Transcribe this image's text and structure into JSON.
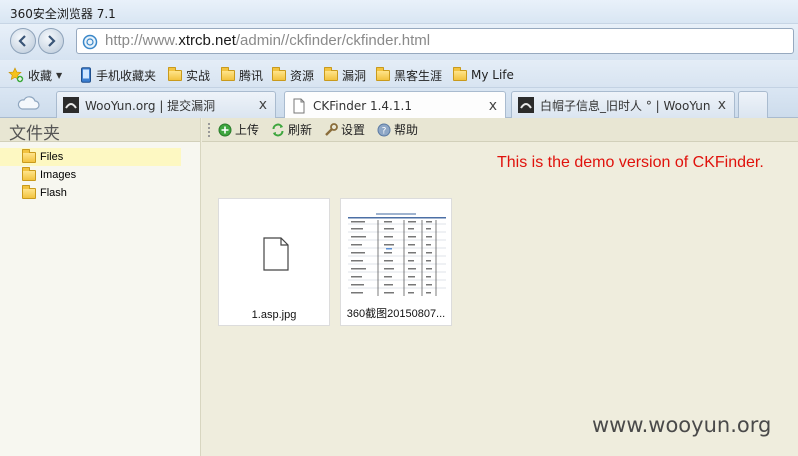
{
  "window": {
    "title": "360安全浏览器 7.1"
  },
  "address_bar": {
    "url_prefix": "http://www.",
    "url_domain": "xtrcb.net",
    "url_path": "/admin//ckfinder/ckfinder.html"
  },
  "bookmarks": {
    "favorites_label": "收藏",
    "items": [
      "手机收藏夹",
      "实战",
      "腾讯",
      "资源",
      "漏洞",
      "黑客生涯",
      "My Life"
    ]
  },
  "tabs": [
    {
      "label": "WooYun.org | 提交漏洞",
      "close": "x"
    },
    {
      "label": "CKFinder 1.4.1.1",
      "close": "x"
    },
    {
      "label": "白帽子信息_旧时人 ° | WooYun",
      "close": "x"
    }
  ],
  "sidebar": {
    "title": "文件夹",
    "folders": [
      "Files",
      "Images",
      "Flash"
    ]
  },
  "toolbar": {
    "upload": "上传",
    "refresh": "刷新",
    "settings": "设置",
    "help": "帮助"
  },
  "notice": "This is the demo version of CKFinder.",
  "files": [
    {
      "name": "1.asp.jpg"
    },
    {
      "name": "360截图20150807..."
    }
  ],
  "watermark": "www.wooyun.org",
  "colors": {
    "notice": "#e0120c",
    "selected_folder_bg": "#fdf8c2"
  }
}
